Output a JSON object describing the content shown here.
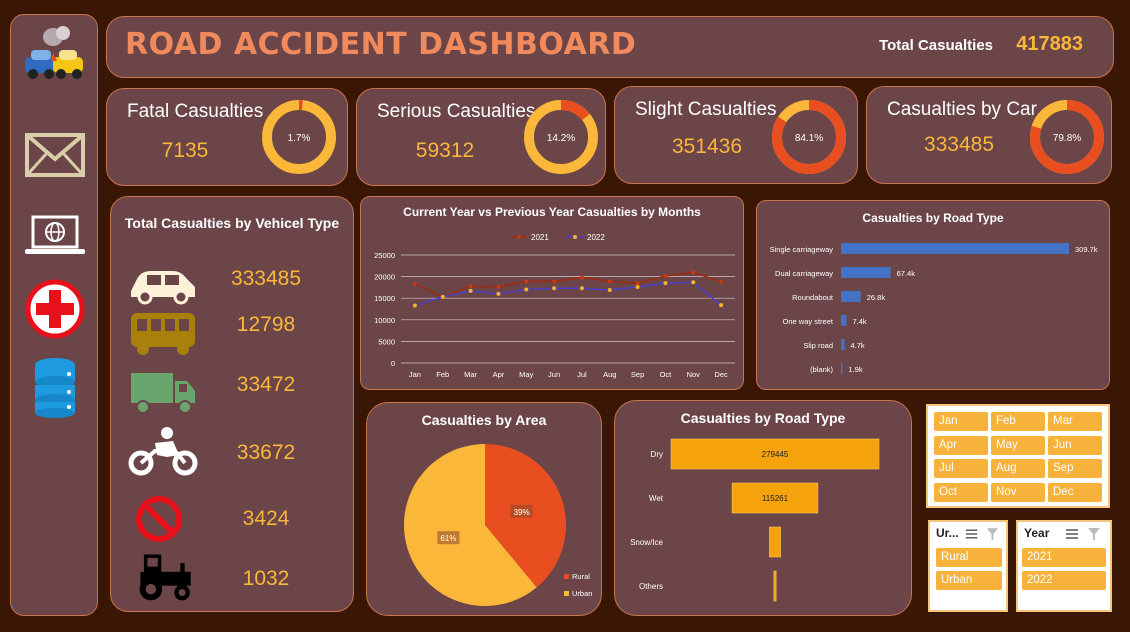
{
  "header": {
    "title": "ROAD ACCIDENT DASHBOARD",
    "total_label": "Total Casualties",
    "total_value": "417883"
  },
  "kpis": [
    {
      "label": "Fatal Casualties",
      "value": "7135",
      "pct_label": "1.7%",
      "pct": 1.7
    },
    {
      "label": "Serious Casualties",
      "value": "59312",
      "pct_label": "14.2%",
      "pct": 14.2
    },
    {
      "label": "Slight Casualties",
      "value": "351436",
      "pct_label": "84.1%",
      "pct": 84.1
    },
    {
      "label": "Casualties by Car",
      "value": "333485",
      "pct_label": "79.8%",
      "pct": 79.8
    }
  ],
  "vehicle_panel": {
    "title": "Total Casualties by Vehicel Type",
    "items": [
      {
        "icon": "car-icon",
        "value": "333485"
      },
      {
        "icon": "bus-icon",
        "value": "12798"
      },
      {
        "icon": "truck-icon",
        "value": "33472"
      },
      {
        "icon": "motorcycle-icon",
        "value": "33672"
      },
      {
        "icon": "no-entry-icon",
        "value": "3424"
      },
      {
        "icon": "tractor-icon",
        "value": "1032"
      }
    ]
  },
  "sidebar_icons": [
    "car-crash-icon",
    "mail-icon",
    "laptop-globe-icon",
    "medical-cross-icon",
    "database-icon"
  ],
  "colors": {
    "accent": "#fbb73a",
    "orange": "#e84e1f",
    "panel": "#6b4548",
    "blue": "#4472c4"
  },
  "chart_data": [
    {
      "type": "line",
      "title": "Current Year vs Previous Year Casualties by Months",
      "categories": [
        "Jan",
        "Feb",
        "Mar",
        "Apr",
        "May",
        "Jun",
        "Jul",
        "Aug",
        "Sep",
        "Oct",
        "Nov",
        "Dec"
      ],
      "series": [
        {
          "name": "2021",
          "color": "#9e2a10",
          "values": [
            18400,
            15200,
            17800,
            17600,
            18900,
            18900,
            19800,
            18900,
            18500,
            20100,
            21000,
            18800
          ]
        },
        {
          "name": "2022",
          "color": "#4c3fc8",
          "values": [
            13300,
            15300,
            16700,
            16000,
            17000,
            17300,
            17300,
            16900,
            17600,
            18500,
            18700,
            13400
          ]
        }
      ],
      "ylim": [
        0,
        25000
      ],
      "yticks": [
        "0",
        "5000",
        "10000",
        "15000",
        "20000",
        "25000"
      ],
      "legend": "top"
    },
    {
      "type": "bar",
      "orientation": "horizontal",
      "title": "Casualties by Road Type",
      "categories": [
        "Single carriageway",
        "Dual carriageway",
        "Roundabout",
        "One way street",
        "Slip road",
        "(blank)"
      ],
      "values": [
        309.7,
        67.4,
        26.8,
        7.4,
        4.7,
        1.9
      ],
      "labels": [
        "309.7k",
        "67.4k",
        "26.8k",
        "7.4k",
        "4.7k",
        "1.9k"
      ]
    },
    {
      "type": "pie",
      "title": "Casualties by Area",
      "slices": [
        {
          "name": "Rural",
          "value": 39,
          "label": "39%",
          "color": "#e84e1f"
        },
        {
          "name": "Urban",
          "value": 61,
          "label": "61%",
          "color": "#fbb73a"
        }
      ],
      "legend": "bottom-right"
    },
    {
      "type": "bar",
      "orientation": "horizontal-funnel",
      "title": "Casualties by Road Type",
      "categories": [
        "Dry",
        "Wet",
        "Snow/Ice",
        "Others"
      ],
      "values": [
        279445,
        115261,
        15000,
        3000
      ],
      "labels": [
        "279445",
        "115261",
        "",
        ""
      ]
    }
  ],
  "slicers": {
    "months": [
      "Jan",
      "Feb",
      "Mar",
      "Apr",
      "May",
      "Jun",
      "Jul",
      "Aug",
      "Sep",
      "Oct",
      "Nov",
      "Dec"
    ],
    "area": {
      "title": "Ur...",
      "items": [
        "Rural",
        "Urban"
      ]
    },
    "year": {
      "title": "Year",
      "items": [
        "2021",
        "2022"
      ]
    }
  }
}
